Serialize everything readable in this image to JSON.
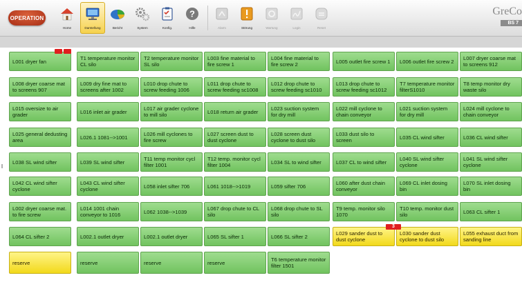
{
  "toolbar": {
    "mode_label": "OPERATION",
    "buttons": [
      {
        "label": "Home",
        "icon": "home-icon",
        "active": false,
        "enabled": true
      },
      {
        "label": "Darstellung",
        "icon": "monitor-icon",
        "active": true,
        "enabled": true
      },
      {
        "label": "Bericht",
        "icon": "pie-chart-icon",
        "active": false,
        "enabled": true
      },
      {
        "label": "System",
        "icon": "gears-icon",
        "active": false,
        "enabled": true
      },
      {
        "label": "Konfig.",
        "icon": "clipboard-icon",
        "active": false,
        "enabled": true
      },
      {
        "label": "Hilfe",
        "icon": "help-icon",
        "active": false,
        "enabled": true
      },
      {
        "label": "Alarm",
        "icon": "alarm-icon",
        "active": false,
        "enabled": false
      },
      {
        "label": "Störung",
        "icon": "fault-icon",
        "active": false,
        "enabled": true
      },
      {
        "label": "Wartung",
        "icon": "wrench-icon",
        "active": false,
        "enabled": false
      },
      {
        "label": "Login",
        "icon": "signature-icon",
        "active": false,
        "enabled": false
      },
      {
        "label": "Reset",
        "icon": "reset-icon",
        "active": false,
        "enabled": false
      }
    ],
    "brand_logo": "GreCo",
    "version_badge": "BS 7"
  },
  "colors": {
    "ok": "#7fcc6c",
    "warning": "#f5de2a",
    "alarm": "#e01f1f",
    "active_tab": "#f6d24e"
  },
  "tiles": [
    [
      "L001 dryer fan",
      "T1 temperature monitor CL silo",
      "T2 temperature monitor SL silo",
      "L003 fine material to fire screw 1",
      "L004 fine material to fire screw 2",
      "L005 outlet fire screw 1",
      "L006 outlet fire screw 2",
      "L007 dryer coarse mat to screens 912"
    ],
    [
      "L008 dryer coarse mat to screens 907",
      "L009 dry fine mat to screens after 1002",
      "L010 drop chute to screw feeding 1006",
      "L011 drop chute to screw feeding sc1008",
      "L012 drop chute to screw feeding sc1010",
      "L013 drop chute to screw feeding sc1012",
      "T7 temperature monitor filterS1010",
      "T8 temp monitor dry waste silo"
    ],
    [
      "L015 oversize to air grader",
      "L016 inlet air grader",
      "L017 air grader cyclone to mill silo",
      "L018 return air grader",
      "L023 suction system for dry mill",
      "L022 mill cyclone to chain conveyor",
      "L021 suction system for dry mill",
      "L024 mill cyclone to chain conveyor"
    ],
    [
      "L025 general dedusting area",
      "L026.1 1081-->1001",
      "L026 mill cyclones to fire screw",
      "L027 screen dust to dust cyclone",
      "L028 screen dust cyclone to dust silo",
      "L033 dust silo to screen",
      "L035 CL wind sifter",
      "L036 CL wind sifter"
    ],
    [
      "L038 SL wind sifter",
      "L039 SL wind sifter",
      "T11 temp monitor cycl filter 1001",
      "T12 temp. monitor cycl filter 1004",
      "L034 SL to wind sifter",
      "L037 CL to wind sifter",
      "L040 SL wind sifter cyclone",
      "L041 SL wind sifter cyclone"
    ],
    [
      "L042 CL wind sifter cyclone",
      "L043 CL wind sifter cyclone",
      "L058 inlet sifter 706",
      "L061 1018-->1019",
      "L059 sifter 706",
      "L060 after dust chain conveyor",
      "L069 CL inlet dosing bin",
      "L070 SL inlet dosing bin"
    ],
    [
      "L002 dryer coarse mat. to fire screw",
      "L014 1001 chain conveyor to 1016",
      "L062 1038-->1039",
      "L067 drop chute to CL silo",
      "L068 drop chute to SL silo",
      "T9 temp. monitor silo 1070",
      "T10 temp. monitor dust silo",
      "L063 CL sifter 1"
    ],
    [
      "L064 CL sifter 2",
      "L002.1 outlet dryer",
      "L002.1 outlet dryer",
      "L065 SL sifter 1",
      "L066 SL sifter 2",
      "L029 sander dust to dust cyclone",
      "L030 sander dust cyclone to dust silo",
      "L055 exhaust duct from sanding line"
    ],
    [
      "reserve",
      "reserve",
      "reserve",
      "reserve",
      "T6 temperature monitor filter 1501"
    ]
  ],
  "tile_status": [
    [
      "alarm",
      "ok",
      "ok",
      "ok",
      "ok",
      "ok",
      "ok",
      "ok"
    ],
    [
      "ok",
      "ok",
      "ok",
      "ok",
      "ok",
      "ok",
      "ok",
      "ok"
    ],
    [
      "ok",
      "ok",
      "ok",
      "ok",
      "ok",
      "ok",
      "ok",
      "ok"
    ],
    [
      "ok",
      "ok",
      "ok",
      "ok",
      "ok",
      "ok",
      "ok",
      "ok"
    ],
    [
      "ok",
      "ok",
      "ok",
      "ok",
      "ok",
      "ok",
      "ok",
      "ok"
    ],
    [
      "ok",
      "ok",
      "ok",
      "ok",
      "ok",
      "ok",
      "ok",
      "ok"
    ],
    [
      "ok",
      "ok",
      "ok",
      "ok",
      "ok",
      "ok",
      "ok",
      "ok"
    ],
    [
      "ok",
      "ok",
      "ok",
      "ok",
      "ok",
      "warning",
      "warning",
      "warning"
    ],
    [
      "warning",
      "ok",
      "ok",
      "ok",
      "ok"
    ]
  ],
  "warning_badge": "3"
}
